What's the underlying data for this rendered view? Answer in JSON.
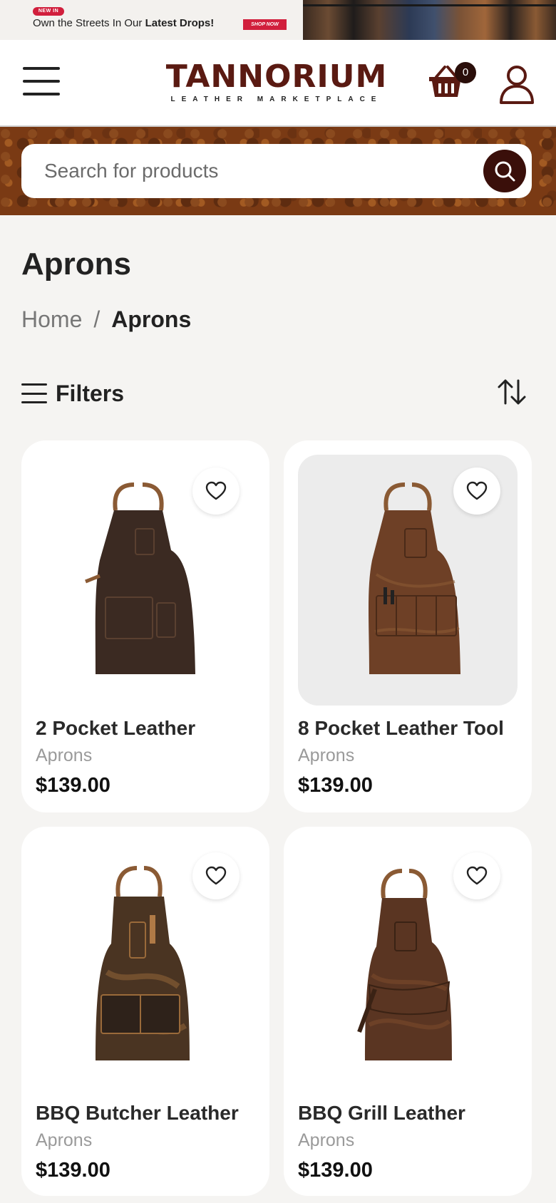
{
  "promo": {
    "badge": "NEW IN",
    "text_prefix": "Own the Streets In Our ",
    "text_bold": "Latest Drops!",
    "cta": "SHOP NOW"
  },
  "header": {
    "logo_wordmark": "TANNORIUM",
    "logo_tagline": "LEATHER MARKETPLACE",
    "cart_count": "0",
    "icons": {
      "menu": "hamburger-menu-icon",
      "cart": "basket-icon",
      "account": "user-icon"
    }
  },
  "search": {
    "placeholder": "Search for products",
    "button_icon": "search-icon"
  },
  "page": {
    "title": "Aprons",
    "breadcrumb": {
      "home": "Home",
      "separator": "/",
      "current": "Aprons"
    }
  },
  "toolbar": {
    "filters_label": "Filters",
    "sort_icon": "sort-arrows-icon"
  },
  "products": [
    {
      "name": "2 Pocket Leather",
      "category": "Aprons",
      "price": "$139.00"
    },
    {
      "name": "8 Pocket Leather Tool",
      "category": "Aprons",
      "price": "$139.00"
    },
    {
      "name": "BBQ Butcher Leather",
      "category": "Aprons",
      "price": "$139.00"
    },
    {
      "name": "BBQ Grill Leather",
      "category": "Aprons",
      "price": "$139.00"
    }
  ],
  "colors": {
    "brand": "#5a1a12",
    "search_button": "#3a0f0a",
    "promo_red": "#d11f3c",
    "background": "#f5f4f2"
  }
}
